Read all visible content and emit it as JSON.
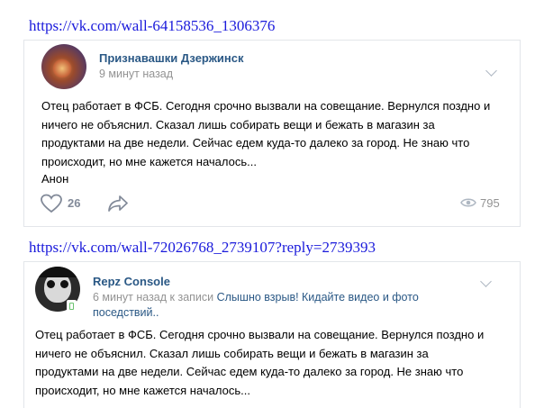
{
  "links": {
    "first": "https://vk.com/wall-64158536_1306376",
    "second": "https://vk.com/wall-72026768_2739107?reply=2739393"
  },
  "post1": {
    "author": "Признавашки Дзержинск",
    "time": "9 минут назад",
    "text": "Отец работает в ФСБ. Сегодня срочно вызвали на совещание. Вернулся поздно и\nничего не объяснил. Сказал лишь собирать вещи и бежать в магазин за\nпродуктами на две недели. Сейчас едем куда-то далеко за город. Не знаю что\nпроисходит, но мне кажется началось...",
    "signature": "Анон",
    "likes": "26",
    "views": "795",
    "icons": [
      "heart-icon",
      "share-icon",
      "eye-icon",
      "chevron-down-icon"
    ]
  },
  "post2": {
    "author": "Repz Console",
    "time_prefix": "6 минут назад к записи",
    "reply_link_line1": "Слышно взрыв! Кидайте видео и фото",
    "reply_link_line2": "поседствий..",
    "text": "Отец работает в ФСБ. Сегодня срочно вызвали на совещание. Вернулся поздно и\nничего не объяснил. Сказал лишь собирать вещи и бежать в магазин за\nпродуктами на две недели. Сейчас едем куда-то далеко за город. Не знаю что\nпроисходит, но мне кажется началось...",
    "icons": [
      "mobile-online-icon",
      "chevron-down-icon"
    ]
  },
  "colors": {
    "link_url": "#1a1adb",
    "vk_name": "#2a5885",
    "meta_gray": "#939393",
    "border": "#e3e6ea"
  }
}
